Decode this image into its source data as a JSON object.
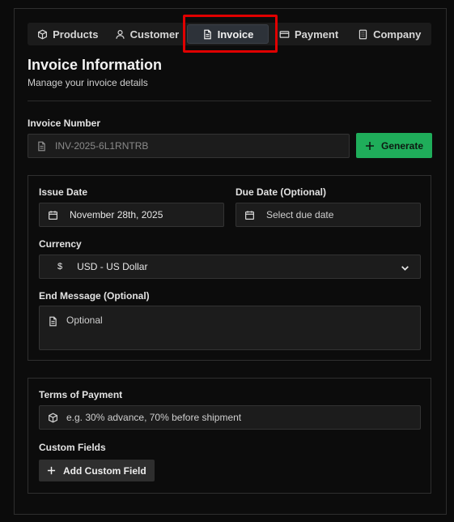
{
  "tabs": [
    {
      "label": "Products",
      "icon": "box-icon"
    },
    {
      "label": "Customer",
      "icon": "user-icon"
    },
    {
      "label": "Invoice",
      "icon": "file-icon",
      "active": true
    },
    {
      "label": "Payment",
      "icon": "credit-card-icon"
    },
    {
      "label": "Company",
      "icon": "building-icon"
    }
  ],
  "header": {
    "title": "Invoice Information",
    "subtitle": "Manage your invoice details"
  },
  "invoice_number": {
    "label": "Invoice Number",
    "value": "INV-2025-6L1RNTRB",
    "generate_label": "Generate"
  },
  "dates": {
    "issue_label": "Issue Date",
    "issue_value": "November 28th, 2025",
    "due_label": "Due Date (Optional)",
    "due_placeholder": "Select due date"
  },
  "currency": {
    "label": "Currency",
    "symbol": "$",
    "value": "USD - US Dollar"
  },
  "end_message": {
    "label": "End Message (Optional)",
    "placeholder": "Optional"
  },
  "terms": {
    "label": "Terms of Payment",
    "placeholder": "e.g. 30% advance, 70% before shipment"
  },
  "custom_fields": {
    "label": "Custom Fields",
    "add_label": "Add Custom Field"
  },
  "colors": {
    "accent": "#1fad5a",
    "highlight": "#e00000"
  }
}
